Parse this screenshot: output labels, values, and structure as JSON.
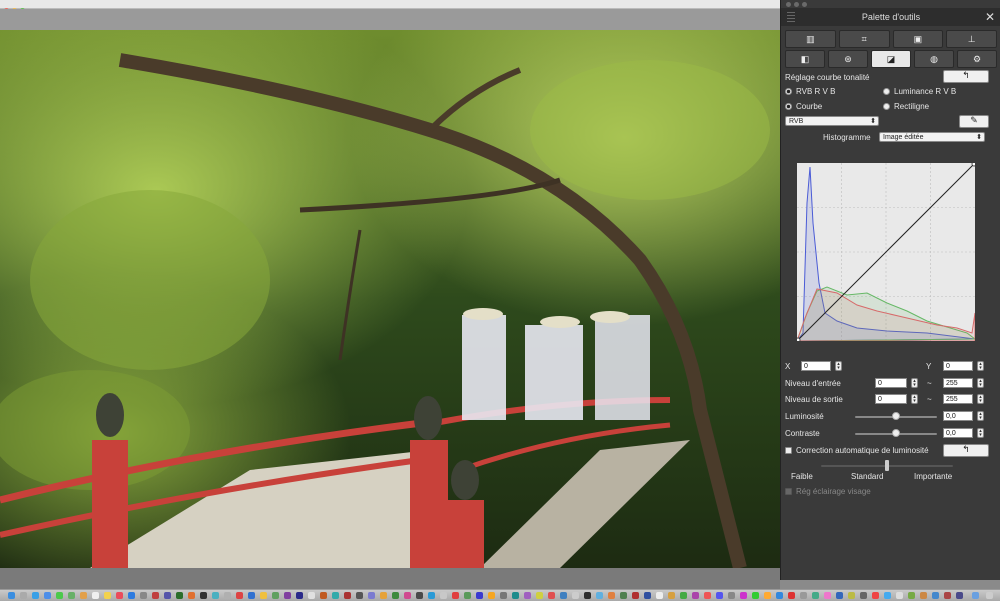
{
  "palette": {
    "title": "Palette d'outils",
    "section_title": "Réglage courbe tonalité",
    "radio_rgb": "RVB R V B",
    "radio_luminance": "Luminance R V B",
    "radio_curve": "Courbe",
    "radio_linear": "Rectiligne",
    "channel_select": "RVB",
    "histogram_label": "Histogramme",
    "histogram_select": "Image éditée",
    "x_label": "X",
    "x_value": "0",
    "y_label": "Y",
    "y_value": "0",
    "input_level_label": "Niveau d'entrée",
    "input_level_low": "0",
    "input_level_high": "255",
    "output_level_label": "Niveau de sortie",
    "output_level_low": "0",
    "output_level_high": "255",
    "tilde": "~",
    "brightness_label": "Luminosité",
    "brightness_value": "0,0",
    "contrast_label": "Contraste",
    "contrast_value": "0,0",
    "auto_brightness_label": "Correction automatique de luminosité",
    "weak_label": "Faible",
    "standard_label": "Standard",
    "strong_label": "Importante",
    "face_light_label": "Rég éclairage visage",
    "brightness_level": 0.5,
    "contrast_level": 0.5,
    "auto_level": 0.5
  },
  "icons": {
    "reset": "reset-arrow-icon",
    "eyedropper": "eyedropper-icon",
    "close": "close-icon"
  },
  "colors": {
    "panel_bg": "#3a3a3a",
    "histogram_blue": "#4a5bd6",
    "histogram_green": "#66b866",
    "histogram_red": "#d66a6a"
  }
}
